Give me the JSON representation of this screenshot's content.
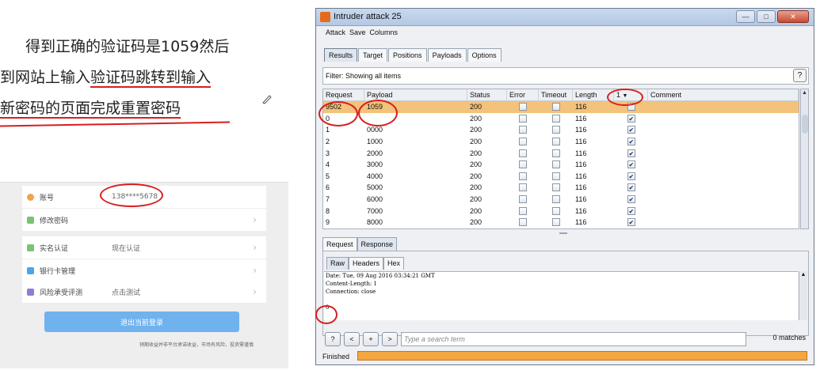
{
  "slide": {
    "line1": "得到正确的验证码是1059然后",
    "line2_a": "到网站上输入",
    "line2_b": "验证码",
    "line2_c": "跳转到输入",
    "line3": "新密码的页面完成重置密码"
  },
  "mobile": {
    "rows": [
      {
        "label": "账号",
        "value": "138****5678",
        "icon_color": "#f0a44a"
      },
      {
        "label": "修改密码",
        "value": "",
        "icon_color": "#7bc274"
      },
      {
        "label": "实名认证",
        "value": "现在认证",
        "icon_color": "#7bc274"
      },
      {
        "label": "银行卡管理",
        "value": "",
        "icon_color": "#4aa6e8"
      },
      {
        "label": "风险承受评测",
        "value": "点击测试",
        "icon_color": "#8a7fd6"
      }
    ],
    "logout_label": "退出当前登录",
    "disclaimer": "预期收益并非平台承诺收益，市场有风险，投资需谨慎"
  },
  "window": {
    "title": "Intruder attack 25",
    "controls": {
      "minimize": "—",
      "maximize": "□",
      "close": "✕"
    },
    "menu": [
      "Attack",
      "Save",
      "Columns"
    ],
    "tabs": [
      "Results",
      "Target",
      "Positions",
      "Payloads",
      "Options"
    ],
    "active_tab": "Results",
    "filter": "Filter: Showing all items",
    "help": "?",
    "columns": {
      "request": "Request",
      "payload": "Payload",
      "status": "Status",
      "error": "Error",
      "timeout": "Timeout",
      "length": "Length",
      "one": "1",
      "comment": "Comment"
    },
    "rows": [
      {
        "request": "9502",
        "payload": "1059",
        "status": "200",
        "error": false,
        "timeout": false,
        "length": "116",
        "one": false,
        "selected": true
      },
      {
        "request": "0",
        "payload": "",
        "status": "200",
        "error": false,
        "timeout": false,
        "length": "116",
        "one": true
      },
      {
        "request": "1",
        "payload": "0000",
        "status": "200",
        "error": false,
        "timeout": false,
        "length": "116",
        "one": true
      },
      {
        "request": "2",
        "payload": "1000",
        "status": "200",
        "error": false,
        "timeout": false,
        "length": "116",
        "one": true
      },
      {
        "request": "3",
        "payload": "2000",
        "status": "200",
        "error": false,
        "timeout": false,
        "length": "116",
        "one": true
      },
      {
        "request": "4",
        "payload": "3000",
        "status": "200",
        "error": false,
        "timeout": false,
        "length": "116",
        "one": true
      },
      {
        "request": "5",
        "payload": "4000",
        "status": "200",
        "error": false,
        "timeout": false,
        "length": "116",
        "one": true
      },
      {
        "request": "6",
        "payload": "5000",
        "status": "200",
        "error": false,
        "timeout": false,
        "length": "116",
        "one": true
      },
      {
        "request": "7",
        "payload": "6000",
        "status": "200",
        "error": false,
        "timeout": false,
        "length": "116",
        "one": true
      },
      {
        "request": "8",
        "payload": "7000",
        "status": "200",
        "error": false,
        "timeout": false,
        "length": "116",
        "one": true
      },
      {
        "request": "9",
        "payload": "8000",
        "status": "200",
        "error": false,
        "timeout": false,
        "length": "116",
        "one": true
      }
    ],
    "reqres_tabs": [
      "Request",
      "Response"
    ],
    "active_reqres": "Response",
    "sub_tabs": [
      "Raw",
      "Headers",
      "Hex"
    ],
    "active_sub": "Raw",
    "raw_lines": [
      "Date: Tue, 09 Aug 2016 03:34:21 GMT",
      "Content-Length: 1",
      "Connection: close",
      "",
      "0"
    ],
    "search_buttons": [
      "?",
      "<",
      "+",
      ">"
    ],
    "search_placeholder": "Type a search term",
    "matches": "0 matches",
    "status": "Finished",
    "progress": 1.0,
    "accent_color": "#f4a740"
  }
}
